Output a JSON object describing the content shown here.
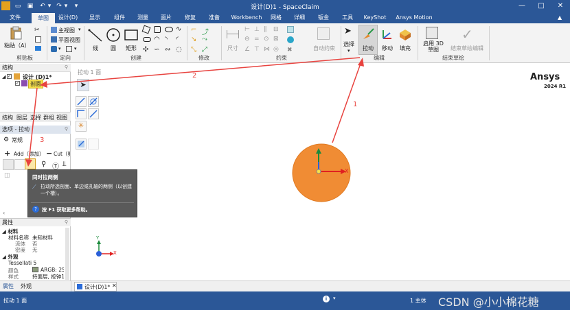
{
  "window": {
    "title": "设计(D)1 - SpaceClaim",
    "controls": [
      "—",
      "□",
      "✕"
    ]
  },
  "menu_tabs": [
    "文件",
    "草图",
    "设计(D)",
    "显示",
    "组件",
    "测量",
    "面片",
    "修复",
    "准备",
    "Workbench",
    "网格",
    "详细",
    "钣金",
    "工具",
    "KeyShot",
    "Ansys Motion"
  ],
  "active_tab": "草图",
  "ribbon": {
    "clipboard": {
      "label": "剪贴板",
      "paste": "粘贴（A）"
    },
    "orient": {
      "label": "定向",
      "main_view": "主视图",
      "plane_view": "平面视图"
    },
    "create": {
      "label": "创建",
      "line": "线",
      "circle": "圆",
      "rectangle": "矩形"
    },
    "modify": {
      "label": "修改"
    },
    "constraints": {
      "label": "约束",
      "dimension": "尺寸",
      "auto_constraint": "自动约束"
    },
    "edit": {
      "label": "编辑",
      "select": "选择",
      "pull": "拉动",
      "move": "移动",
      "fill": "填充"
    },
    "end_sketch": {
      "label": "结束草绘",
      "enable_3d": "启用 3D 草图",
      "end_edit": "结束草绘编辑"
    }
  },
  "structure": {
    "title": "结构",
    "root": "设计 (D)1*",
    "child": "剖面"
  },
  "panel_tabs": [
    "结构",
    "图层",
    "选择",
    "群组",
    "视图"
  ],
  "options": {
    "title": "选项 - 拉动",
    "section": "常规",
    "add_label": "Add（添加）",
    "cut_label": "Cut（剪"
  },
  "tooltip": {
    "title": "同时拉两侧",
    "body": "拉动所选剖面、单边或孔轴的两侧（以创建一个槽）。",
    "help": "按 F1 获取更多帮助。"
  },
  "properties": {
    "title": "属性",
    "material_section": "材料",
    "material_name_label": "材料名称",
    "material_name": "未知材料",
    "fluid_label": "流体",
    "fluid": "否",
    "density_label": "密度",
    "density": "无",
    "appearance_section": "外观",
    "tessellation": "Tessellati 5",
    "color_label": "颜色",
    "color_value": "ARGB: 25",
    "style_label": "样式",
    "style_value": "持面层, 按钟1"
  },
  "left_bottom_tabs": [
    "属性",
    "外观"
  ],
  "canvas": {
    "mode_label": "拉动 1 面",
    "brand": "Ansys",
    "version": "2024 R1",
    "axis_x": "X",
    "axis_y": "Y"
  },
  "annotations": [
    "1",
    "2",
    "3"
  ],
  "doc_tab": "设计(D)1*",
  "status": {
    "left": "拉动 1 面",
    "bodies": "1 主体",
    "watermark": "CSDN @小小棉花糖"
  },
  "colors": {
    "chrome_blue": "#2b5797",
    "arrow_red": "#e8433f",
    "disk_orange": "#f08c34",
    "highlight_yellow": "#f6e04b"
  }
}
